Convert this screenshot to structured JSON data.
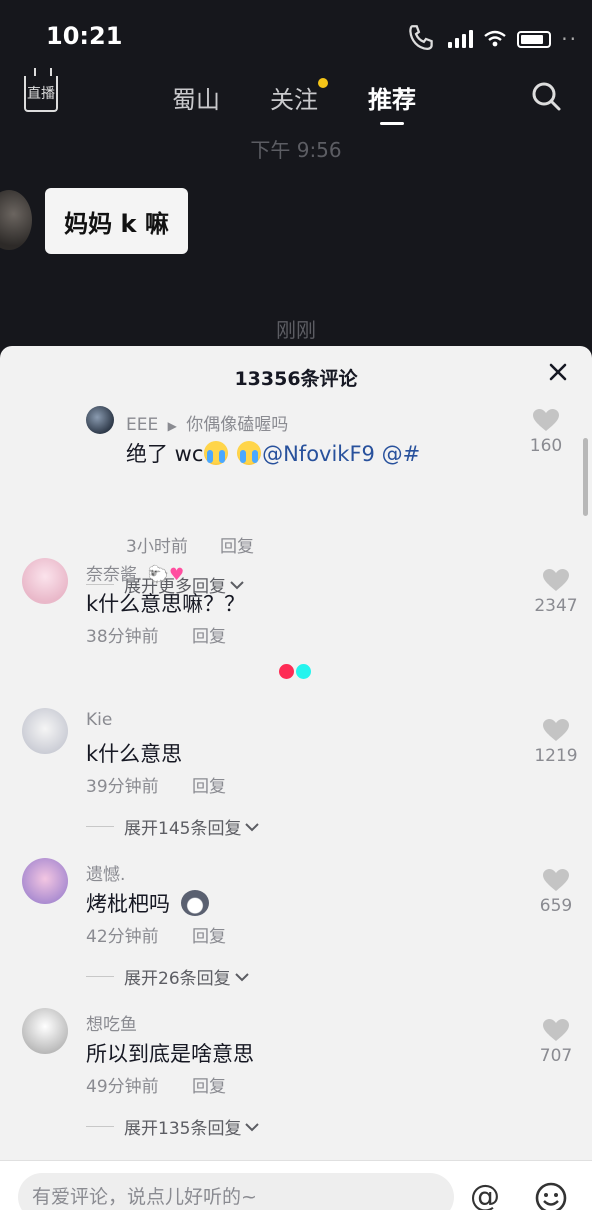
{
  "status_bar": {
    "time": "10:21"
  },
  "nav": {
    "live_label": "直播",
    "tabs": [
      "蜀山",
      "关注",
      "推荐"
    ]
  },
  "chat": {
    "timestamp_1": "下午 9:56",
    "bubble_text": "妈妈 k 嘛",
    "timestamp_2": "刚刚"
  },
  "comments_sheet": {
    "title": "13356条评论",
    "reply_thread": {
      "username": "EEE",
      "reply_to": "你偶像磕喔吗",
      "text_prefix": "绝了 wc",
      "mention": "@NfovikF9 @#",
      "time": "3小时前",
      "reply_label": "回复",
      "likes": "160",
      "expand_label": "展开更多回复"
    },
    "comments": [
      {
        "username": "奈奈酱.",
        "text": "k什么意思嘛？？",
        "time": "38分钟前",
        "reply_label": "回复",
        "likes": "2347",
        "expand_label": ""
      },
      {
        "username": "Kie",
        "text": "k什么意思",
        "time": "39分钟前",
        "reply_label": "回复",
        "likes": "1219",
        "expand_label": "展开145条回复"
      },
      {
        "username": "遗憾.",
        "text": "烤枇杷吗",
        "time": "42分钟前",
        "reply_label": "回复",
        "likes": "659",
        "expand_label": "展开26条回复"
      },
      {
        "username": "想吃鱼",
        "text": "所以到底是啥意思",
        "time": "49分钟前",
        "reply_label": "回复",
        "likes": "707",
        "expand_label": "展开135条回复"
      }
    ]
  },
  "input_bar": {
    "placeholder": "有爱评论，说点儿好听的~"
  },
  "colors": {
    "background_dark": "#16171c",
    "sheet_bg": "#f2f2f2",
    "mention": "#28519c",
    "loader_red": "#fe2c55",
    "loader_cyan": "#25f4ee"
  }
}
